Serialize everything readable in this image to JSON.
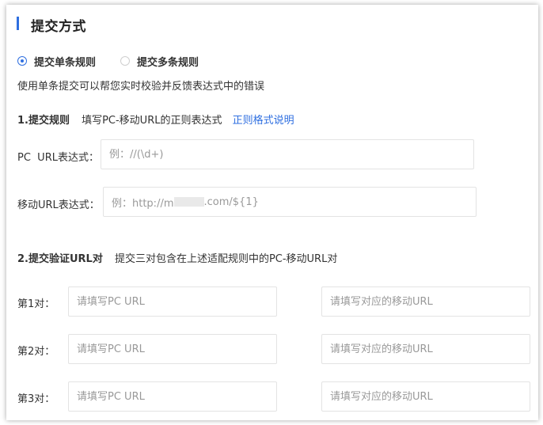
{
  "section_title": "提交方式",
  "submit_mode": {
    "single_label": "提交单条规则",
    "multi_label": "提交多条规则",
    "selected": "single"
  },
  "description": "使用单条提交可以帮您实时校验并反馈表达式中的错误",
  "rules": {
    "heading": "1.提交规则",
    "hint": "填写PC-移动URL的正则表达式",
    "help_link": "正则格式说明",
    "pc_label": "PC  URL表达式：",
    "pc_placeholder": "例：//(\\d+)",
    "mobile_label": "移动URL表达式：",
    "mobile_placeholder_prefix": "例：http://m",
    "mobile_placeholder_suffix": ".com/${1}"
  },
  "verify": {
    "heading": "2.提交验证URL对",
    "hint": "提交三对包含在上述适配规则中的PC-移动URL对",
    "pc_placeholder": "请填写PC URL",
    "mobile_placeholder": "请填写对应的移动URL",
    "pairs": [
      {
        "label": "第1对："
      },
      {
        "label": "第2对："
      },
      {
        "label": "第3对："
      }
    ]
  }
}
